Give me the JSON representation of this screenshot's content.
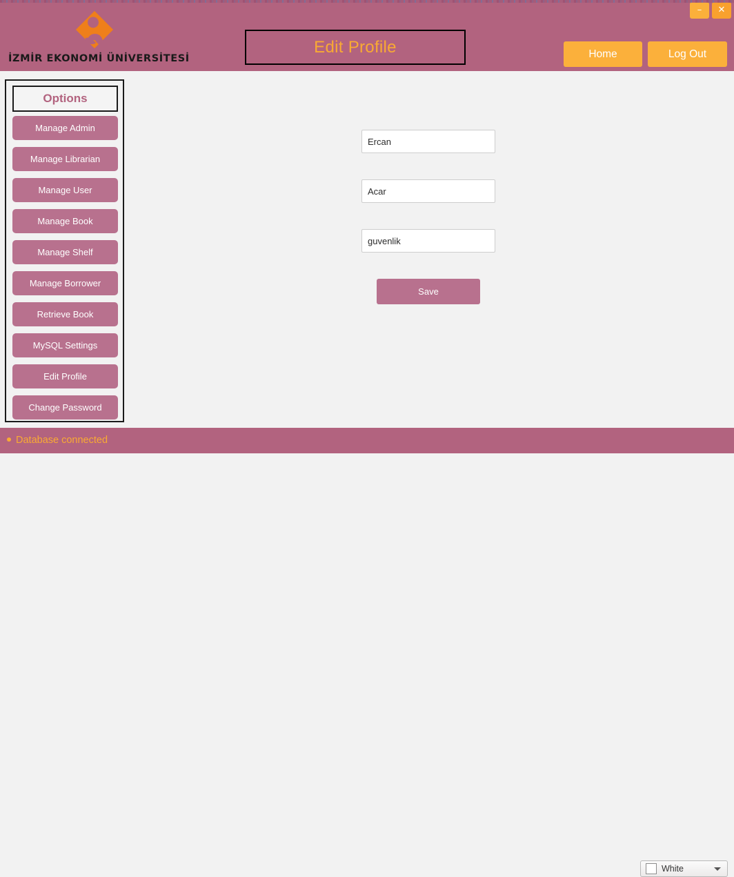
{
  "window": {
    "minimize_label": "–",
    "close_label": "✕"
  },
  "header": {
    "logo_text": "İZMİR EKONOMİ ÜNİVERSİTESİ",
    "logo_icon": "izmir-ekonomi-diamond-logo",
    "title": "Edit Profile",
    "home_label": "Home",
    "logout_label": "Log Out",
    "background_color": "#b2637f",
    "title_color": "#f9aa33",
    "button_color": "#fbb03b"
  },
  "sidebar": {
    "heading": "Options",
    "items": [
      {
        "label": "Manage Admin"
      },
      {
        "label": "Manage Librarian"
      },
      {
        "label": "Manage User"
      },
      {
        "label": "Manage Book"
      },
      {
        "label": "Manage Shelf"
      },
      {
        "label": "Manage Borrower"
      },
      {
        "label": "Retrieve Book"
      },
      {
        "label": "MySQL Settings"
      },
      {
        "label": "Edit Profile"
      },
      {
        "label": "Change Password"
      }
    ],
    "button_color": "#b8718e"
  },
  "form": {
    "fields": [
      {
        "name": "first-name",
        "value": "Ercan",
        "placeholder": ""
      },
      {
        "name": "last-name",
        "value": "Acar",
        "placeholder": ""
      },
      {
        "name": "password",
        "value": "guvenlik",
        "placeholder": ""
      }
    ],
    "save_label": "Save"
  },
  "status": {
    "text": "Database connected",
    "dot_icon": "status-dot-icon",
    "text_color": "#f9aa33"
  },
  "theme": {
    "swatch_icon": "color-swatch-icon",
    "selected": "White",
    "caret_icon": "chevron-down-icon"
  }
}
